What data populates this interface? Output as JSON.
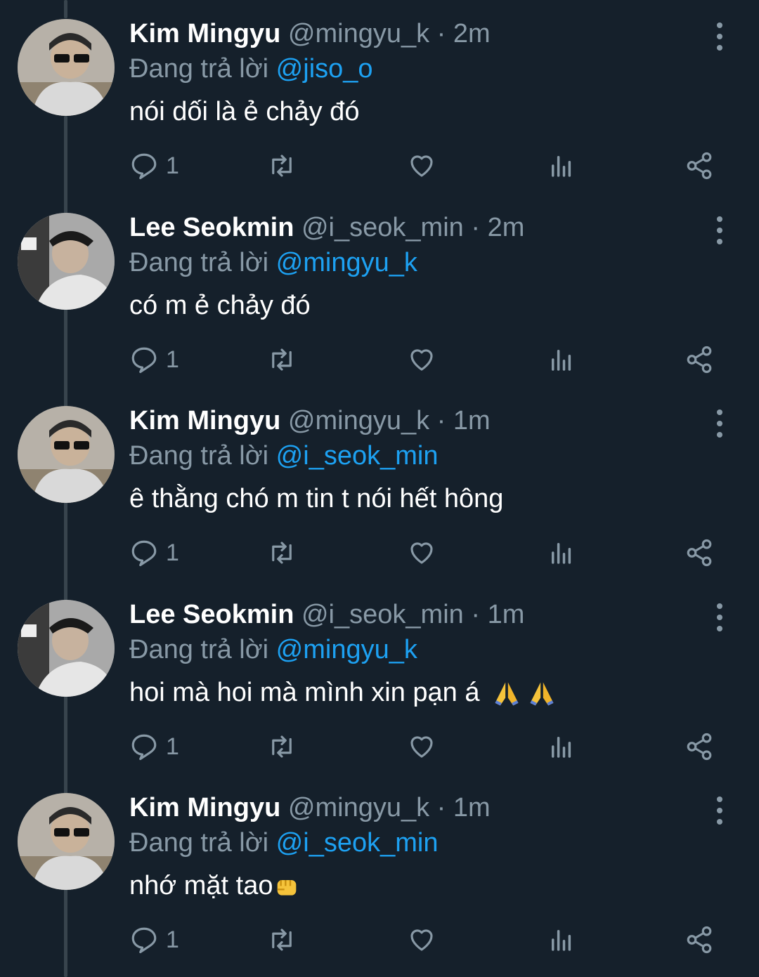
{
  "colors": {
    "background": "#15202b",
    "muted": "#8899a6",
    "mention": "#1da1f2",
    "thread_line": "#38444d"
  },
  "tweets": [
    {
      "name": "Kim Mingyu",
      "handle": "@mingyu_k",
      "time": "2m",
      "reply_prefix": "Đang trả lời",
      "reply_to": "@jiso_o",
      "text": "nói dối là ẻ chảy đó",
      "reply_count": "1",
      "avatar": "avatar-mingyu"
    },
    {
      "name": "Lee Seokmin",
      "handle": "@i_seok_min",
      "time": "2m",
      "reply_prefix": "Đang trả lời",
      "reply_to": "@mingyu_k",
      "text": "có m ẻ chảy đó",
      "reply_count": "1",
      "avatar": "avatar-seokmin"
    },
    {
      "name": "Kim Mingyu",
      "handle": "@mingyu_k",
      "time": "1m",
      "reply_prefix": "Đang trả lời",
      "reply_to": "@i_seok_min",
      "text": "ê thằng chó m tin t nói hết hông",
      "reply_count": "1",
      "avatar": "avatar-mingyu"
    },
    {
      "name": "Lee Seokmin",
      "handle": "@i_seok_min",
      "time": "1m",
      "reply_prefix": "Đang trả lời",
      "reply_to": "@mingyu_k",
      "text": "hoi mà hoi mà mình xin pạn á",
      "emoji": "folded-hands-icon x2",
      "reply_count": "1",
      "avatar": "avatar-seokmin"
    },
    {
      "name": "Kim Mingyu",
      "handle": "@mingyu_k",
      "time": "1m",
      "reply_prefix": "Đang trả lời",
      "reply_to": "@i_seok_min",
      "text": "nhớ mặt tao",
      "emoji": "oncoming-fist-icon",
      "reply_count": "1",
      "avatar": "avatar-mingyu"
    }
  ],
  "separator": "·"
}
